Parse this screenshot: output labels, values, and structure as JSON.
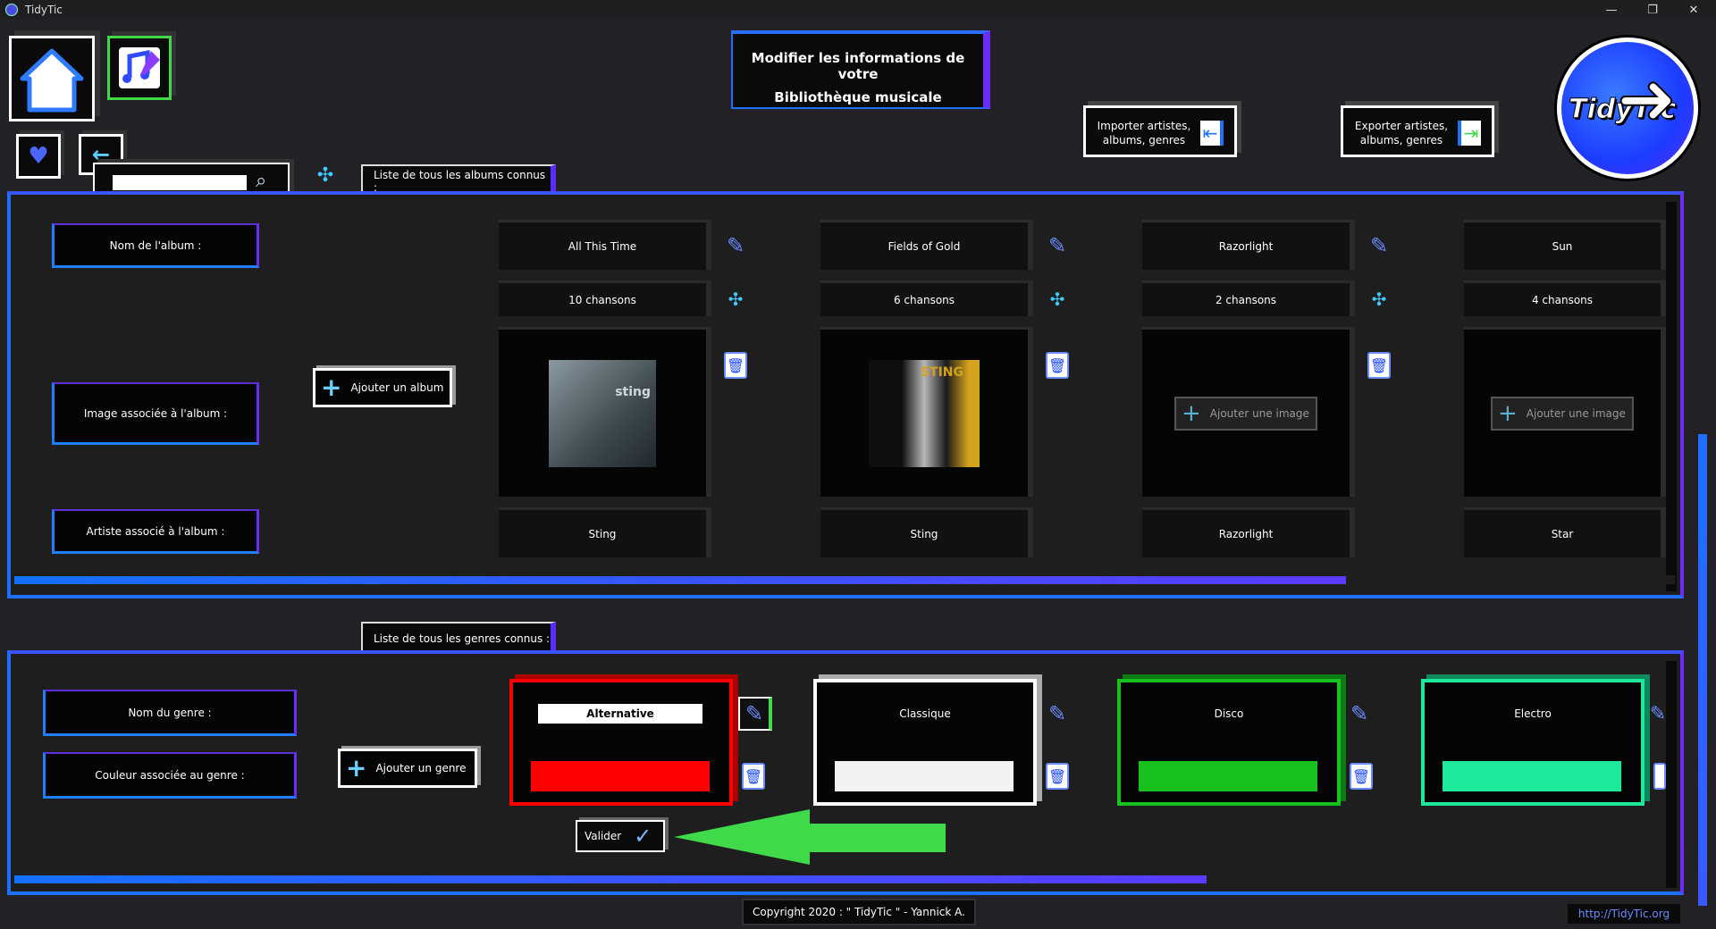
{
  "window": {
    "title": "TidyTic",
    "min": "—",
    "max": "❐",
    "close": "✕"
  },
  "header": {
    "title_line1": "Modifier les informations de votre",
    "title_line2": "Bibliothèque musicale",
    "import_label": "Importer artistes, albums, genres",
    "export_label": "Exporter artistes, albums, genres",
    "logo_text": "TidyTic"
  },
  "search": {
    "placeholder": "",
    "value": ""
  },
  "albums": {
    "tab_label": "Liste de tous les albums connus :",
    "row_labels": {
      "name": "Nom de l'album :",
      "image": "Image associée à l'album :",
      "artist": "Artiste associé à l'album :"
    },
    "add_label": "Ajouter un album",
    "items": [
      {
        "name": "All This Time",
        "count": "10 chansons",
        "artist": "Sting",
        "has_image": true,
        "cover_text": "sting"
      },
      {
        "name": "Fields of Gold",
        "count": "6 chansons",
        "artist": "Sting",
        "has_image": true,
        "cover_text": "STING"
      },
      {
        "name": "Razorlight",
        "count": "2 chansons",
        "artist": "Razorlight",
        "has_image": false
      },
      {
        "name": "Sun",
        "count": "4 chansons",
        "artist": "Star",
        "has_image": false
      }
    ],
    "add_image_label": "Ajouter une image"
  },
  "genres": {
    "tab_label": "Liste de tous les genres connus :",
    "row_labels": {
      "name": "Nom du genre :",
      "color": "Couleur associée au genre :"
    },
    "add_label": "Ajouter un genre",
    "items": [
      {
        "name": "Alternative",
        "color": "#ff0000",
        "editing": true
      },
      {
        "name": "Classique",
        "color": "#f2f2f2",
        "editing": false
      },
      {
        "name": "Disco",
        "color": "#17c21f",
        "editing": false
      },
      {
        "name": "Electro",
        "color": "#1de89c",
        "editing": false
      }
    ],
    "validate_label": "Valider"
  },
  "footer": {
    "copyright": "Copyright 2020 : \" TidyTic \" - Yannick A.",
    "link": "http://TidyTic.org"
  },
  "colors": {
    "accent_blue": "#1f6fff",
    "accent_purple": "#6b2cff",
    "arrow_green": "#3fd94a"
  }
}
